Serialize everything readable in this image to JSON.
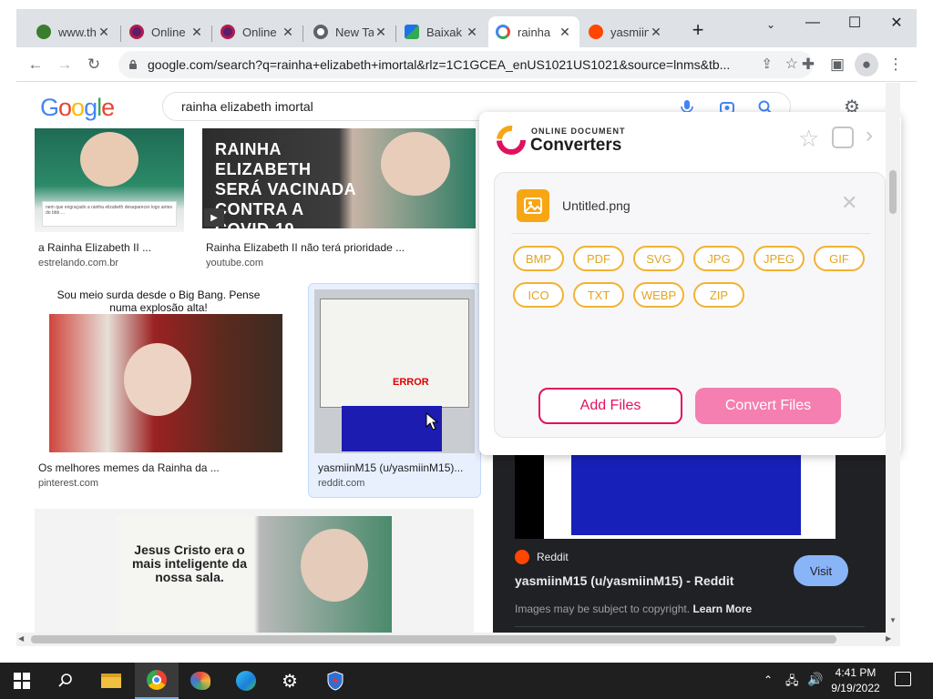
{
  "browser": {
    "tabs": [
      {
        "label": "www.th",
        "favicon": "frog-favicon",
        "color": "#3a7d2c"
      },
      {
        "label": "Online",
        "favicon": "online-favicon",
        "color": "#5b1e6b"
      },
      {
        "label": "Online",
        "favicon": "online-favicon",
        "color": "#5b1e6b"
      },
      {
        "label": "New Ta",
        "favicon": "chrome-favicon",
        "color": "#5f6368"
      },
      {
        "label": "Baixak",
        "favicon": "baixaki-favicon",
        "color": "#1e8e3e"
      },
      {
        "label": "rainha",
        "favicon": "google-favicon",
        "color": "#4285f4"
      },
      {
        "label": "yasmiin",
        "favicon": "reddit-favicon",
        "color": "#ff4500"
      }
    ],
    "url": "google.com/search?q=rainha+elizabeth+imortal&rlz=1C1GCEA_enUS1021US1021&source=lnms&tb..."
  },
  "google": {
    "logo": "Google",
    "query": "rainha elizabeth imortal"
  },
  "results": [
    {
      "caption": "a Rainha Elizabeth II ...",
      "source": "estrelando.com.br",
      "thumb_text": "nem que engraçado a rainha elizabeth desaparecer logo antes do bbb ..."
    },
    {
      "caption": "Rainha Elizabeth II não terá prioridade ...",
      "source": "youtube.com",
      "thumb_text": "RAINHA ELIZABETH SERÁ VACINADA CONTRA A COVID-19"
    },
    {
      "caption": "Os melhores memes da Rainha da ...",
      "source": "pinterest.com",
      "thumb_text": "Sou meio surda desde o Big Bang. Pense numa explosão alta!"
    },
    {
      "caption": "yasmiinM15 (u/yasmiinM15)...",
      "source": "reddit.com",
      "thumb_text": "ERROR"
    },
    {
      "caption": "",
      "source": "",
      "thumb_text": "Jesus Cristo era o mais inteligente da nossa sala."
    }
  ],
  "preview": {
    "site": "Reddit",
    "title": "yasmiinM15 (u/yasmiinM15) - Reddit",
    "visit_label": "Visit",
    "copyright": "Images may be subject to copyright.",
    "learn_more": "Learn More"
  },
  "extension": {
    "brand_small": "ONLINE DOCUMENT",
    "brand_big": "Converters",
    "file_name": "Untitled.png",
    "formats": [
      "BMP",
      "PDF",
      "SVG",
      "JPG",
      "JPEG",
      "GIF",
      "ICO",
      "TXT",
      "WEBP",
      "ZIP"
    ],
    "add_files": "Add Files",
    "convert_files": "Convert Files",
    "accent": "#e0115f"
  },
  "taskbar": {
    "time": "4:41 PM",
    "date": "9/19/2022",
    "apps": [
      "start-icon",
      "search-icon",
      "file-explorer-icon",
      "chrome-icon",
      "paint-icon",
      "edge-icon",
      "settings-icon",
      "security-icon"
    ]
  }
}
